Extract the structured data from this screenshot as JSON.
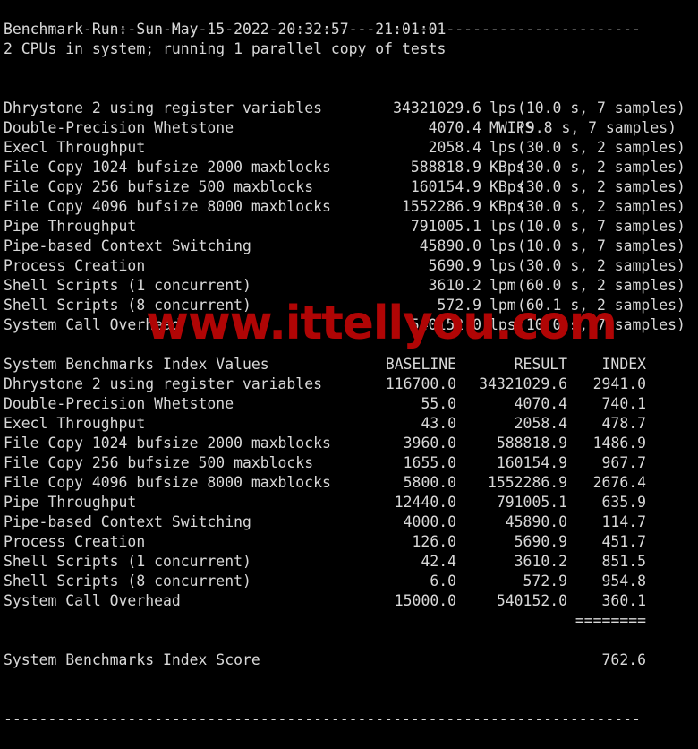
{
  "terminal": {
    "top_rule": "------------------------------------------------------------------------",
    "bottom_rule": "------------------------------------------------------------------------",
    "header": {
      "benchmark_run": "Benchmark Run: Sun May 15 2022 20:32:57 - 21:01:01",
      "cpu_line": "2 CPUs in system; running 1 parallel copy of tests"
    },
    "results": [
      {
        "name": "Dhrystone 2 using register variables",
        "value": "34321029.6",
        "unit": "lps",
        "detail": "(10.0 s, 7 samples)"
      },
      {
        "name": "Double-Precision Whetstone",
        "value": "4070.4",
        "unit": "MWIPS",
        "detail": "(9.8 s, 7 samples)"
      },
      {
        "name": "Execl Throughput",
        "value": "2058.4",
        "unit": "lps",
        "detail": "(30.0 s, 2 samples)"
      },
      {
        "name": "File Copy 1024 bufsize 2000 maxblocks",
        "value": "588818.9",
        "unit": "KBps",
        "detail": "(30.0 s, 2 samples)"
      },
      {
        "name": "File Copy 256 bufsize 500 maxblocks",
        "value": "160154.9",
        "unit": "KBps",
        "detail": "(30.0 s, 2 samples)"
      },
      {
        "name": "File Copy 4096 bufsize 8000 maxblocks",
        "value": "1552286.9",
        "unit": "KBps",
        "detail": "(30.0 s, 2 samples)"
      },
      {
        "name": "Pipe Throughput",
        "value": "791005.1",
        "unit": "lps",
        "detail": "(10.0 s, 7 samples)"
      },
      {
        "name": "Pipe-based Context Switching",
        "value": "45890.0",
        "unit": "lps",
        "detail": "(10.0 s, 7 samples)"
      },
      {
        "name": "Process Creation",
        "value": "5690.9",
        "unit": "lps",
        "detail": "(30.0 s, 2 samples)"
      },
      {
        "name": "Shell Scripts (1 concurrent)",
        "value": "3610.2",
        "unit": "lpm",
        "detail": "(60.0 s, 2 samples)"
      },
      {
        "name": "Shell Scripts (8 concurrent)",
        "value": "572.9",
        "unit": "lpm",
        "detail": "(60.1 s, 2 samples)"
      },
      {
        "name": "System Call Overhead",
        "value": "540152.0",
        "unit": "lps",
        "detail": "(10.0 s, 7 samples)"
      }
    ],
    "index_table": {
      "title": "System Benchmarks Index Values",
      "columns": {
        "baseline": "BASELINE",
        "result": "RESULT",
        "index": "INDEX"
      },
      "rows": [
        {
          "name": "Dhrystone 2 using register variables",
          "baseline": "116700.0",
          "result": "34321029.6",
          "index": "2941.0"
        },
        {
          "name": "Double-Precision Whetstone",
          "baseline": "55.0",
          "result": "4070.4",
          "index": "740.1"
        },
        {
          "name": "Execl Throughput",
          "baseline": "43.0",
          "result": "2058.4",
          "index": "478.7"
        },
        {
          "name": "File Copy 1024 bufsize 2000 maxblocks",
          "baseline": "3960.0",
          "result": "588818.9",
          "index": "1486.9"
        },
        {
          "name": "File Copy 256 bufsize 500 maxblocks",
          "baseline": "1655.0",
          "result": "160154.9",
          "index": "967.7"
        },
        {
          "name": "File Copy 4096 bufsize 8000 maxblocks",
          "baseline": "5800.0",
          "result": "1552286.9",
          "index": "2676.4"
        },
        {
          "name": "Pipe Throughput",
          "baseline": "12440.0",
          "result": "791005.1",
          "index": "635.9"
        },
        {
          "name": "Pipe-based Context Switching",
          "baseline": "4000.0",
          "result": "45890.0",
          "index": "114.7"
        },
        {
          "name": "Process Creation",
          "baseline": "126.0",
          "result": "5690.9",
          "index": "451.7"
        },
        {
          "name": "Shell Scripts (1 concurrent)",
          "baseline": "42.4",
          "result": "3610.2",
          "index": "851.5"
        },
        {
          "name": "Shell Scripts (8 concurrent)",
          "baseline": "6.0",
          "result": "572.9",
          "index": "954.8"
        },
        {
          "name": "System Call Overhead",
          "baseline": "15000.0",
          "result": "540152.0",
          "index": "360.1"
        }
      ],
      "separator": "========",
      "score_label": "System Benchmarks Index Score",
      "score_value": "762.6"
    },
    "watermark": "www.ittellyou.com",
    "colors": {
      "background": "#000000",
      "text": "#d8d8d8",
      "watermark": "#b00505"
    }
  }
}
